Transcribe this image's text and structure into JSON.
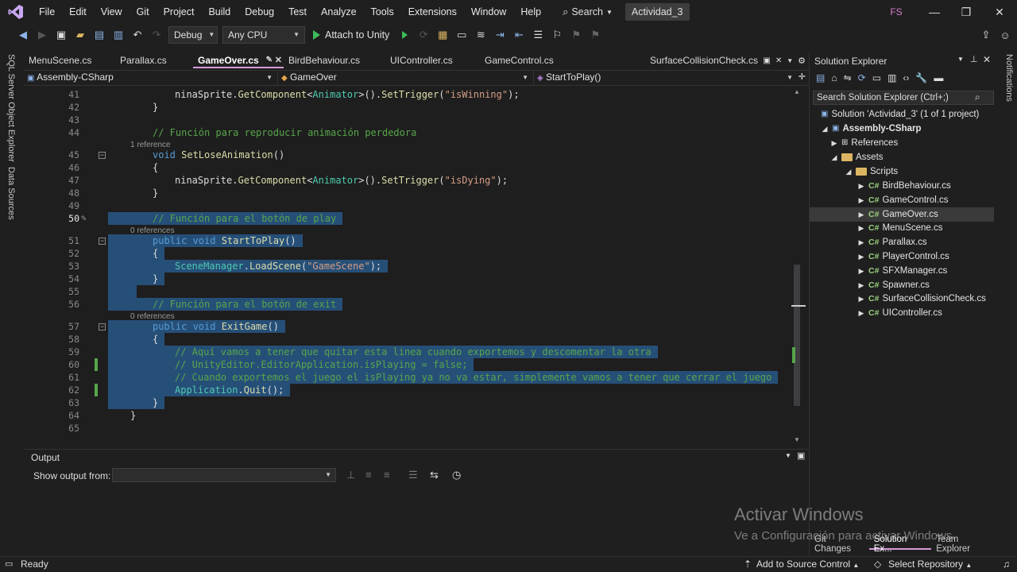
{
  "menubar": {
    "items": [
      "File",
      "Edit",
      "View",
      "Git",
      "Project",
      "Build",
      "Debug",
      "Test",
      "Analyze",
      "Tools",
      "Extensions",
      "Window",
      "Help"
    ],
    "search_label": "Search",
    "solution_name": "Actividad_3",
    "user_initials": "FS"
  },
  "toolbar": {
    "config": "Debug",
    "platform": "Any CPU",
    "attach_label": "Attach to Unity"
  },
  "left_rail": {
    "sql_explorer": "SQL Server Object Explorer",
    "data_sources": "Data Sources"
  },
  "right_rail": {
    "notifications": "Notifications"
  },
  "tabs": [
    {
      "label": "MenuScene.cs",
      "active": false
    },
    {
      "label": "Parallax.cs",
      "active": false
    },
    {
      "label": "GameOver.cs",
      "active": true
    },
    {
      "label": "BirdBehaviour.cs",
      "active": false
    },
    {
      "label": "UIController.cs",
      "active": false
    },
    {
      "label": "GameControl.cs",
      "active": false
    },
    {
      "label": "SurfaceCollisionCheck.cs",
      "active": false
    }
  ],
  "navbar": {
    "project": "Assembly-CSharp",
    "class": "GameOver",
    "member": "StartToPlay()"
  },
  "editor": {
    "lines": [
      {
        "n": "41",
        "indent": 2,
        "tokens": [
          [
            "",
            "ninaSprite."
          ],
          [
            "fn",
            "GetComponent"
          ],
          [
            "",
            "<"
          ],
          [
            "ty",
            "Animator"
          ],
          [
            "",
            ">()."
          ],
          [
            "fn",
            "SetTrigger"
          ],
          [
            "",
            "("
          ],
          [
            "str",
            "\"isWinning\""
          ],
          [
            "",
            ");"
          ]
        ]
      },
      {
        "n": "42",
        "indent": 1,
        "tokens": [
          [
            "",
            "}"
          ]
        ]
      },
      {
        "n": "43",
        "indent": 0,
        "tokens": []
      },
      {
        "n": "44",
        "indent": 1,
        "tokens": [
          [
            "cm",
            "// Función para reproducir animación perdedora"
          ]
        ]
      },
      {
        "n": "45",
        "indent": 1,
        "ref": "1 reference",
        "fold": true,
        "tokens": [
          [
            "kw",
            "void "
          ],
          [
            "fn",
            "SetLoseAnimation"
          ],
          [
            "",
            "()"
          ]
        ]
      },
      {
        "n": "46",
        "indent": 1,
        "tokens": [
          [
            "",
            "{"
          ]
        ]
      },
      {
        "n": "47",
        "indent": 2,
        "tokens": [
          [
            "",
            "ninaSprite."
          ],
          [
            "fn",
            "GetComponent"
          ],
          [
            "",
            "<"
          ],
          [
            "ty",
            "Animator"
          ],
          [
            "",
            ">()."
          ],
          [
            "fn",
            "SetTrigger"
          ],
          [
            "",
            "("
          ],
          [
            "str",
            "\"isDying\""
          ],
          [
            "",
            ");"
          ]
        ]
      },
      {
        "n": "48",
        "indent": 1,
        "tokens": [
          [
            "",
            "}"
          ]
        ]
      },
      {
        "n": "49",
        "indent": 0,
        "tokens": []
      },
      {
        "n": "50",
        "indent": 1,
        "sel": true,
        "cur": true,
        "tokens": [
          [
            "cm",
            "// Función para el botón de play"
          ]
        ]
      },
      {
        "n": "51",
        "indent": 1,
        "sel": true,
        "ref": "0 references",
        "fold": true,
        "tokens": [
          [
            "kw",
            "public void "
          ],
          [
            "fn",
            "StartToPlay"
          ],
          [
            "",
            "()"
          ]
        ]
      },
      {
        "n": "52",
        "indent": 1,
        "sel": true,
        "tokens": [
          [
            "",
            "{"
          ]
        ]
      },
      {
        "n": "53",
        "indent": 2,
        "sel": true,
        "tokens": [
          [
            "ty",
            "SceneManager"
          ],
          [
            "",
            "."
          ],
          [
            "fn",
            "LoadScene"
          ],
          [
            "",
            "("
          ],
          [
            "str",
            "\"GameScene\""
          ],
          [
            "",
            ");"
          ]
        ]
      },
      {
        "n": "54",
        "indent": 1,
        "sel": true,
        "tokens": [
          [
            "",
            "}"
          ]
        ]
      },
      {
        "n": "55",
        "indent": 0,
        "sel": true,
        "tokens": []
      },
      {
        "n": "56",
        "indent": 1,
        "sel": true,
        "tokens": [
          [
            "cm",
            "// Función para el botón de exit"
          ]
        ]
      },
      {
        "n": "57",
        "indent": 1,
        "sel": true,
        "ref": "0 references",
        "fold": true,
        "tokens": [
          [
            "kw",
            "public void "
          ],
          [
            "fn",
            "ExitGame"
          ],
          [
            "",
            "()"
          ]
        ]
      },
      {
        "n": "58",
        "indent": 1,
        "sel": true,
        "tokens": [
          [
            "",
            "{"
          ]
        ]
      },
      {
        "n": "59",
        "indent": 2,
        "sel": true,
        "tokens": [
          [
            "cm",
            "// Aquí vamos a tener que quitar esta linea cuando exportemos y descomentar la otra"
          ]
        ]
      },
      {
        "n": "60",
        "indent": 2,
        "sel": true,
        "chg": true,
        "tokens": [
          [
            "cm",
            "// UnityEditor.EditorApplication.isPlaying = false;"
          ]
        ]
      },
      {
        "n": "61",
        "indent": 2,
        "sel": true,
        "tokens": [
          [
            "cm",
            "// Cuando exportemos el juego el isPlaying ya no va estar, simplemente vamos a tener que cerrar el juego"
          ]
        ]
      },
      {
        "n": "62",
        "indent": 2,
        "sel": true,
        "chg": true,
        "tokens": [
          [
            "ty",
            "Application"
          ],
          [
            "",
            "."
          ],
          [
            "fn",
            "Quit"
          ],
          [
            "",
            "();"
          ]
        ]
      },
      {
        "n": "63",
        "indent": 1,
        "sel": true,
        "tokens": [
          [
            "",
            "}"
          ]
        ]
      },
      {
        "n": "64",
        "indent": 0,
        "tokens": [
          [
            "",
            "}"
          ]
        ]
      },
      {
        "n": "65",
        "indent": 0,
        "tokens": []
      }
    ]
  },
  "output": {
    "title": "Output",
    "show_from_label": "Show output from:"
  },
  "solution_explorer": {
    "title": "Solution Explorer",
    "search_placeholder": "Search Solution Explorer (Ctrl+;)",
    "solution_label": "Solution 'Actividad_3' (1 of 1 project)",
    "project_label": "Assembly-CSharp",
    "references_label": "References",
    "assets_label": "Assets",
    "scripts_label": "Scripts",
    "files": [
      "BirdBehaviour.cs",
      "GameControl.cs",
      "GameOver.cs",
      "MenuScene.cs",
      "Parallax.cs",
      "PlayerControl.cs",
      "SFXManager.cs",
      "Spawner.cs",
      "SurfaceCollisionCheck.cs",
      "UIController.cs"
    ],
    "selected_file": "GameOver.cs",
    "bottom_tabs": [
      "Git Changes",
      "Solution Ex...",
      "Team Explorer"
    ]
  },
  "watermark": {
    "title": "Activar Windows",
    "subtitle": "Ve a Configuración para activar Windows."
  },
  "statusbar": {
    "status": "Ready",
    "source_control": "Add to Source Control",
    "repository": "Select Repository"
  }
}
